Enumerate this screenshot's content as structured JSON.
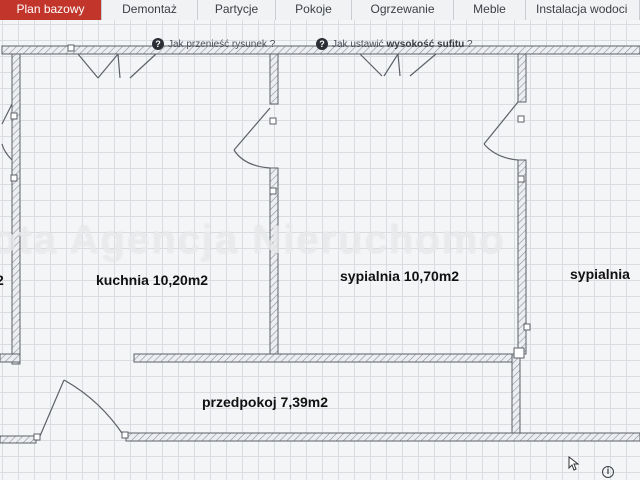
{
  "tabs": [
    {
      "label": "Plan bazowy",
      "active": true
    },
    {
      "label": "Demontaż",
      "active": false
    },
    {
      "label": "Partycje",
      "active": false
    },
    {
      "label": "Pokoje",
      "active": false
    },
    {
      "label": "Ogrzewanie",
      "active": false
    },
    {
      "label": "Meble",
      "active": false
    },
    {
      "label": "Instalacja wodoci",
      "active": false
    }
  ],
  "hints": [
    {
      "pre": "Jak przenieść rysunek ?",
      "bold": "",
      "post": ""
    },
    {
      "pre": "Jak ustawić ",
      "bold": "wysokość sufitu",
      "post": " ?"
    }
  ],
  "rooms": {
    "left_partial": "2",
    "kuchnia": "kuchnia 10,20m2",
    "sypialnia1": "sypialnia 10,70m2",
    "sypialnia2": "sypialnia",
    "przedpokoj": "przedpokoj 7,39m2"
  },
  "watermark": "ota Agencja Nieruchomo",
  "colors": {
    "accent_tab": "#c2352b",
    "wall_fill": "#e6e8eb",
    "wall_stroke": "#5d6168",
    "grid": "#d9dce1"
  },
  "icons": {
    "hint": "help-icon",
    "cursor": "cursor-icon",
    "info": "info-icon"
  }
}
